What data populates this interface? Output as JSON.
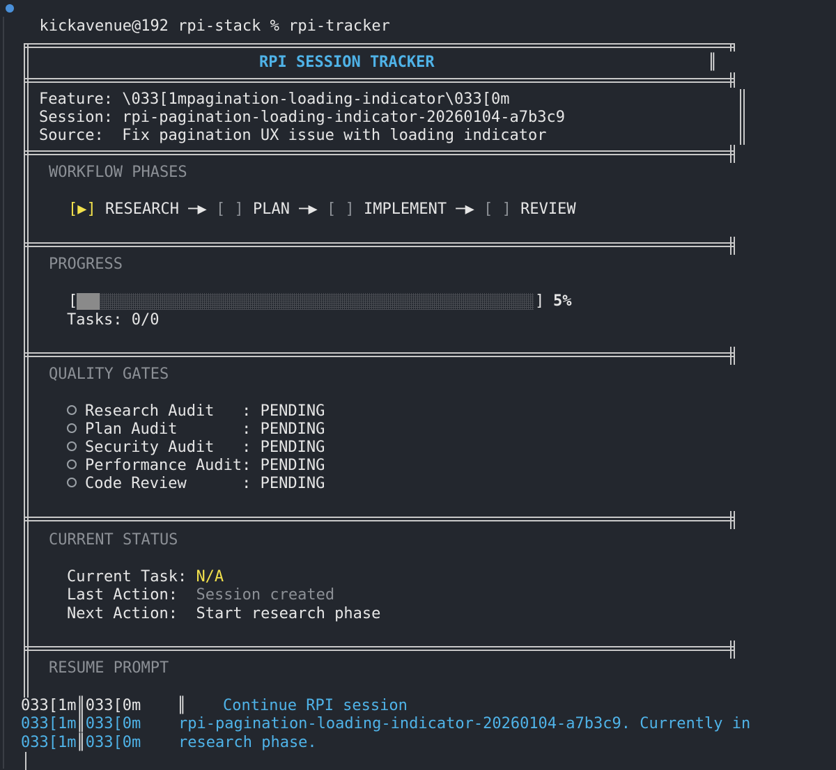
{
  "prompt": {
    "user_host": "kickavenue@192",
    "cwd": "rpi-stack",
    "symbol": "%",
    "command": "rpi-tracker"
  },
  "header": {
    "title": "RPI SESSION TRACKER",
    "bars": "║"
  },
  "info": {
    "feature_label": "Feature:",
    "feature_value": "\\033[1mpagination-loading-indicator\\033[0m",
    "session_label": "Session:",
    "session_value": "rpi-pagination-loading-indicator-20260104-a7b3c9",
    "source_label": "Source:",
    "source_value": "Fix pagination UX issue with loading indicator"
  },
  "workflow": {
    "heading": "WORKFLOW PHASES",
    "phases": [
      {
        "marker": "[▶]",
        "name": "RESEARCH",
        "active": true
      },
      {
        "marker": "[ ]",
        "name": "PLAN",
        "active": false
      },
      {
        "marker": "[ ]",
        "name": "IMPLEMENT",
        "active": false
      },
      {
        "marker": "[ ]",
        "name": "REVIEW",
        "active": false
      }
    ],
    "arrow": "─▶"
  },
  "progress": {
    "heading": "PROGRESS",
    "open_bracket": "[",
    "close_bracket": "]",
    "percent_label": "5%",
    "percent": 5,
    "tasks_label": "Tasks: 0/0"
  },
  "quality_gates": {
    "heading": "QUALITY GATES",
    "items": [
      {
        "name": "Research Audit   ",
        "status": "PENDING"
      },
      {
        "name": "Plan Audit       ",
        "status": "PENDING"
      },
      {
        "name": "Security Audit   ",
        "status": "PENDING"
      },
      {
        "name": "Performance Audit",
        "status": "PENDING"
      },
      {
        "name": "Code Review      ",
        "status": "PENDING"
      }
    ],
    "separator": ": "
  },
  "current_status": {
    "heading": "CURRENT STATUS",
    "task_label": "Current Task:",
    "task_value": "N/A",
    "last_label": "Last Action:",
    "last_value": "Session created",
    "next_label": "Next Action:",
    "next_value": "Start research phase"
  },
  "resume": {
    "heading": "RESUME PROMPT",
    "escape_prefix": "033[1m",
    "escape_mid": "║",
    "escape_suffix": "033[0m",
    "bar": "║",
    "line1": "Continue RPI session",
    "line2": "rpi-pagination-loading-indicator-20260104-a7b3c9. Currently in",
    "line3": "research phase."
  },
  "colors": {
    "background": "#23272e",
    "accent_cyan": "#4fb3e8",
    "accent_yellow": "#f2e14c",
    "dim_text": "#8c9096"
  }
}
